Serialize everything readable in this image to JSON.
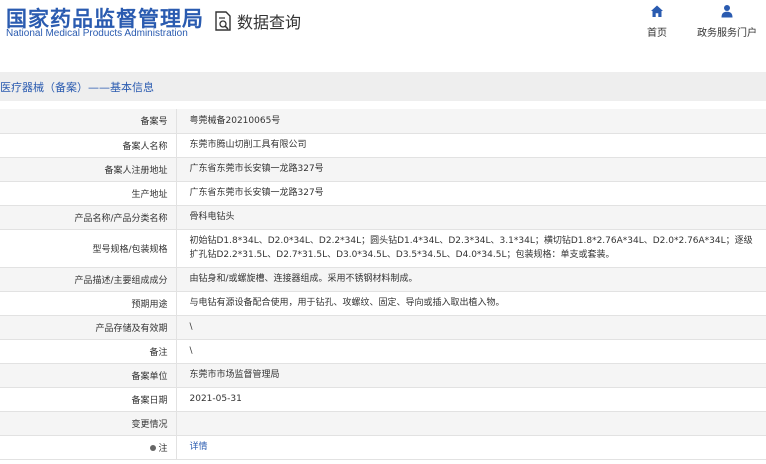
{
  "header": {
    "site_name_cn": "国家药品监督管理局",
    "site_name_en": "National Medical Products Administration",
    "page_title": "数据查询",
    "nav_home": "首页",
    "nav_portal": "政务服务门户"
  },
  "section": {
    "title": "医疗器械（备案）——基本信息"
  },
  "rows": [
    {
      "label": "备案号",
      "value": "粤莞械备20210065号"
    },
    {
      "label": "备案人名称",
      "value": "东莞市腾山切削工具有限公司"
    },
    {
      "label": "备案人注册地址",
      "value": "广东省东莞市长安镇一龙路327号"
    },
    {
      "label": "生产地址",
      "value": "广东省东莞市长安镇一龙路327号"
    },
    {
      "label": "产品名称/产品分类名称",
      "value": "骨科电钻头"
    },
    {
      "label": "型号规格/包装规格",
      "value": "初始钻D1.8*34L、D2.0*34L、D2.2*34L；圆头钻D1.4*34L、D2.3*34L、3.1*34L；横切钻D1.8*2.76A*34L、D2.0*2.76A*34L；逐级扩孔钻D2.2*31.5L、D2.7*31.5L、D3.0*34.5L、D3.5*34.5L、D4.0*34.5L；包装规格：单支或套装。"
    },
    {
      "label": "产品描述/主要组成成分",
      "value": "由钻身和/或螺旋槽、连接器组成。采用不锈钢材料制成。"
    },
    {
      "label": "预期用途",
      "value": "与电钻有源设备配合使用，用于钻孔、攻螺纹、固定、导向或插入取出植入物。"
    },
    {
      "label": "产品存储及有效期",
      "value": "\\"
    },
    {
      "label": "备注",
      "value": "\\"
    },
    {
      "label": "备案单位",
      "value": "东莞市市场监督管理局"
    },
    {
      "label": "备案日期",
      "value": "2021-05-31"
    },
    {
      "label": "变更情况",
      "value": ""
    },
    {
      "label": "注",
      "value": "详情"
    }
  ]
}
